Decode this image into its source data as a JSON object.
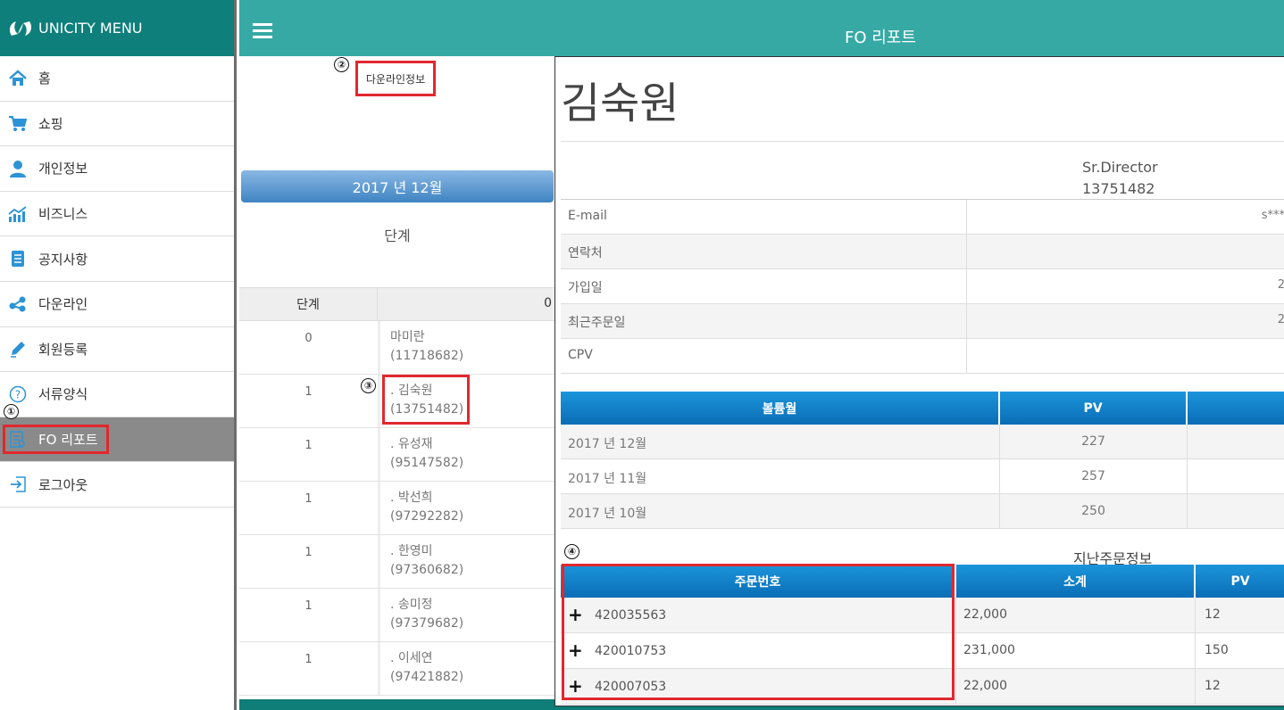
{
  "sidebar": {
    "title": "UNICITY MENU",
    "items": [
      {
        "label": "홈",
        "icon": "home-icon"
      },
      {
        "label": "쇼핑",
        "icon": "cart-icon"
      },
      {
        "label": "개인정보",
        "icon": "user-icon"
      },
      {
        "label": "비즈니스",
        "icon": "chart-icon"
      },
      {
        "label": "공지사항",
        "icon": "document-icon"
      },
      {
        "label": "다운라인",
        "icon": "share-icon"
      },
      {
        "label": "회원등록",
        "icon": "pencil-icon"
      },
      {
        "label": "서류양식",
        "icon": "question-icon"
      },
      {
        "label": "FO 리포트",
        "icon": "report-icon",
        "active": true
      },
      {
        "label": "로그아웃",
        "icon": "logout-icon"
      }
    ]
  },
  "topbar": {
    "title": "FO 리포트"
  },
  "markers": {
    "m1": "①",
    "m2": "②",
    "m3": "③",
    "m4": "④"
  },
  "report": {
    "downline_link": "다운라인정보",
    "month": "2017 년 12월",
    "step_label": "단계",
    "table_headers": [
      "단계",
      "0"
    ],
    "rows": [
      {
        "step": "0",
        "name": "마미란",
        "id": "(11718682)"
      },
      {
        "step": "1",
        "name": ". 김숙원",
        "id": "(13751482)"
      },
      {
        "step": "1",
        "name": ". 유성재",
        "id": "(95147582)"
      },
      {
        "step": "1",
        "name": ". 박선희",
        "id": "(97292282)"
      },
      {
        "step": "1",
        "name": ". 한영미",
        "id": "(97360682)"
      },
      {
        "step": "1",
        "name": ". 송미정",
        "id": "(97379682)"
      },
      {
        "step": "1",
        "name": ". 이세연",
        "id": "(97421882)"
      }
    ]
  },
  "detail": {
    "name": "김숙원",
    "rank": "Sr.Director",
    "member_id": "13751482",
    "info": [
      {
        "key": "E-mail",
        "value": "s***"
      },
      {
        "key": "연락처",
        "value": ""
      },
      {
        "key": "가입일",
        "value": "2"
      },
      {
        "key": "최근주문일",
        "value": "2"
      },
      {
        "key": "CPV",
        "value": ""
      }
    ],
    "volume_headers": [
      "볼륨월",
      "PV",
      ""
    ],
    "volume_rows": [
      {
        "month": "2017 년 12월",
        "pv": "227"
      },
      {
        "month": "2017 년 11월",
        "pv": "257"
      },
      {
        "month": "2017 년 10월",
        "pv": "250"
      }
    ],
    "orders_title": "지난주문정보",
    "order_headers": [
      "주문번호",
      "소계",
      "PV"
    ],
    "orders": [
      {
        "order_no": "420035563",
        "subtotal": "22,000",
        "pv": "12"
      },
      {
        "order_no": "420010753",
        "subtotal": "231,000",
        "pv": "150"
      },
      {
        "order_no": "420007053",
        "subtotal": "22,000",
        "pv": "12"
      }
    ]
  },
  "colors": {
    "brand": "#0e7f7a",
    "topbar": "#37a9a4",
    "highlight": "#e0282f",
    "table_header": "#0a6db6"
  }
}
